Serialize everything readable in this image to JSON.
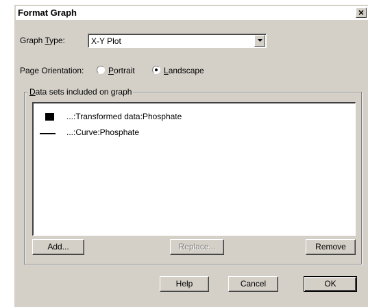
{
  "window": {
    "title": "Format Graph",
    "close_glyph": "✕"
  },
  "graph_type": {
    "label_pre": "Graph ",
    "label_key": "T",
    "label_post": "ype:",
    "value": "X-Y Plot"
  },
  "orientation": {
    "label": "Page Orientation:",
    "options": [
      {
        "key": "P",
        "rest": "ortrait",
        "selected": false
      },
      {
        "key": "L",
        "rest": "andscape",
        "selected": true
      }
    ]
  },
  "datasets": {
    "group_label_key": "D",
    "group_label_rest": "ata sets included on graph",
    "items": [
      {
        "marker": "square",
        "label": "...:Transformed data:Phosphate"
      },
      {
        "marker": "line",
        "label": "...:Curve:Phosphate"
      }
    ]
  },
  "buttons": {
    "add": "Add...",
    "replace": "Replace...",
    "remove": "Remove",
    "help": "Help",
    "cancel": "Cancel",
    "ok": "OK"
  }
}
